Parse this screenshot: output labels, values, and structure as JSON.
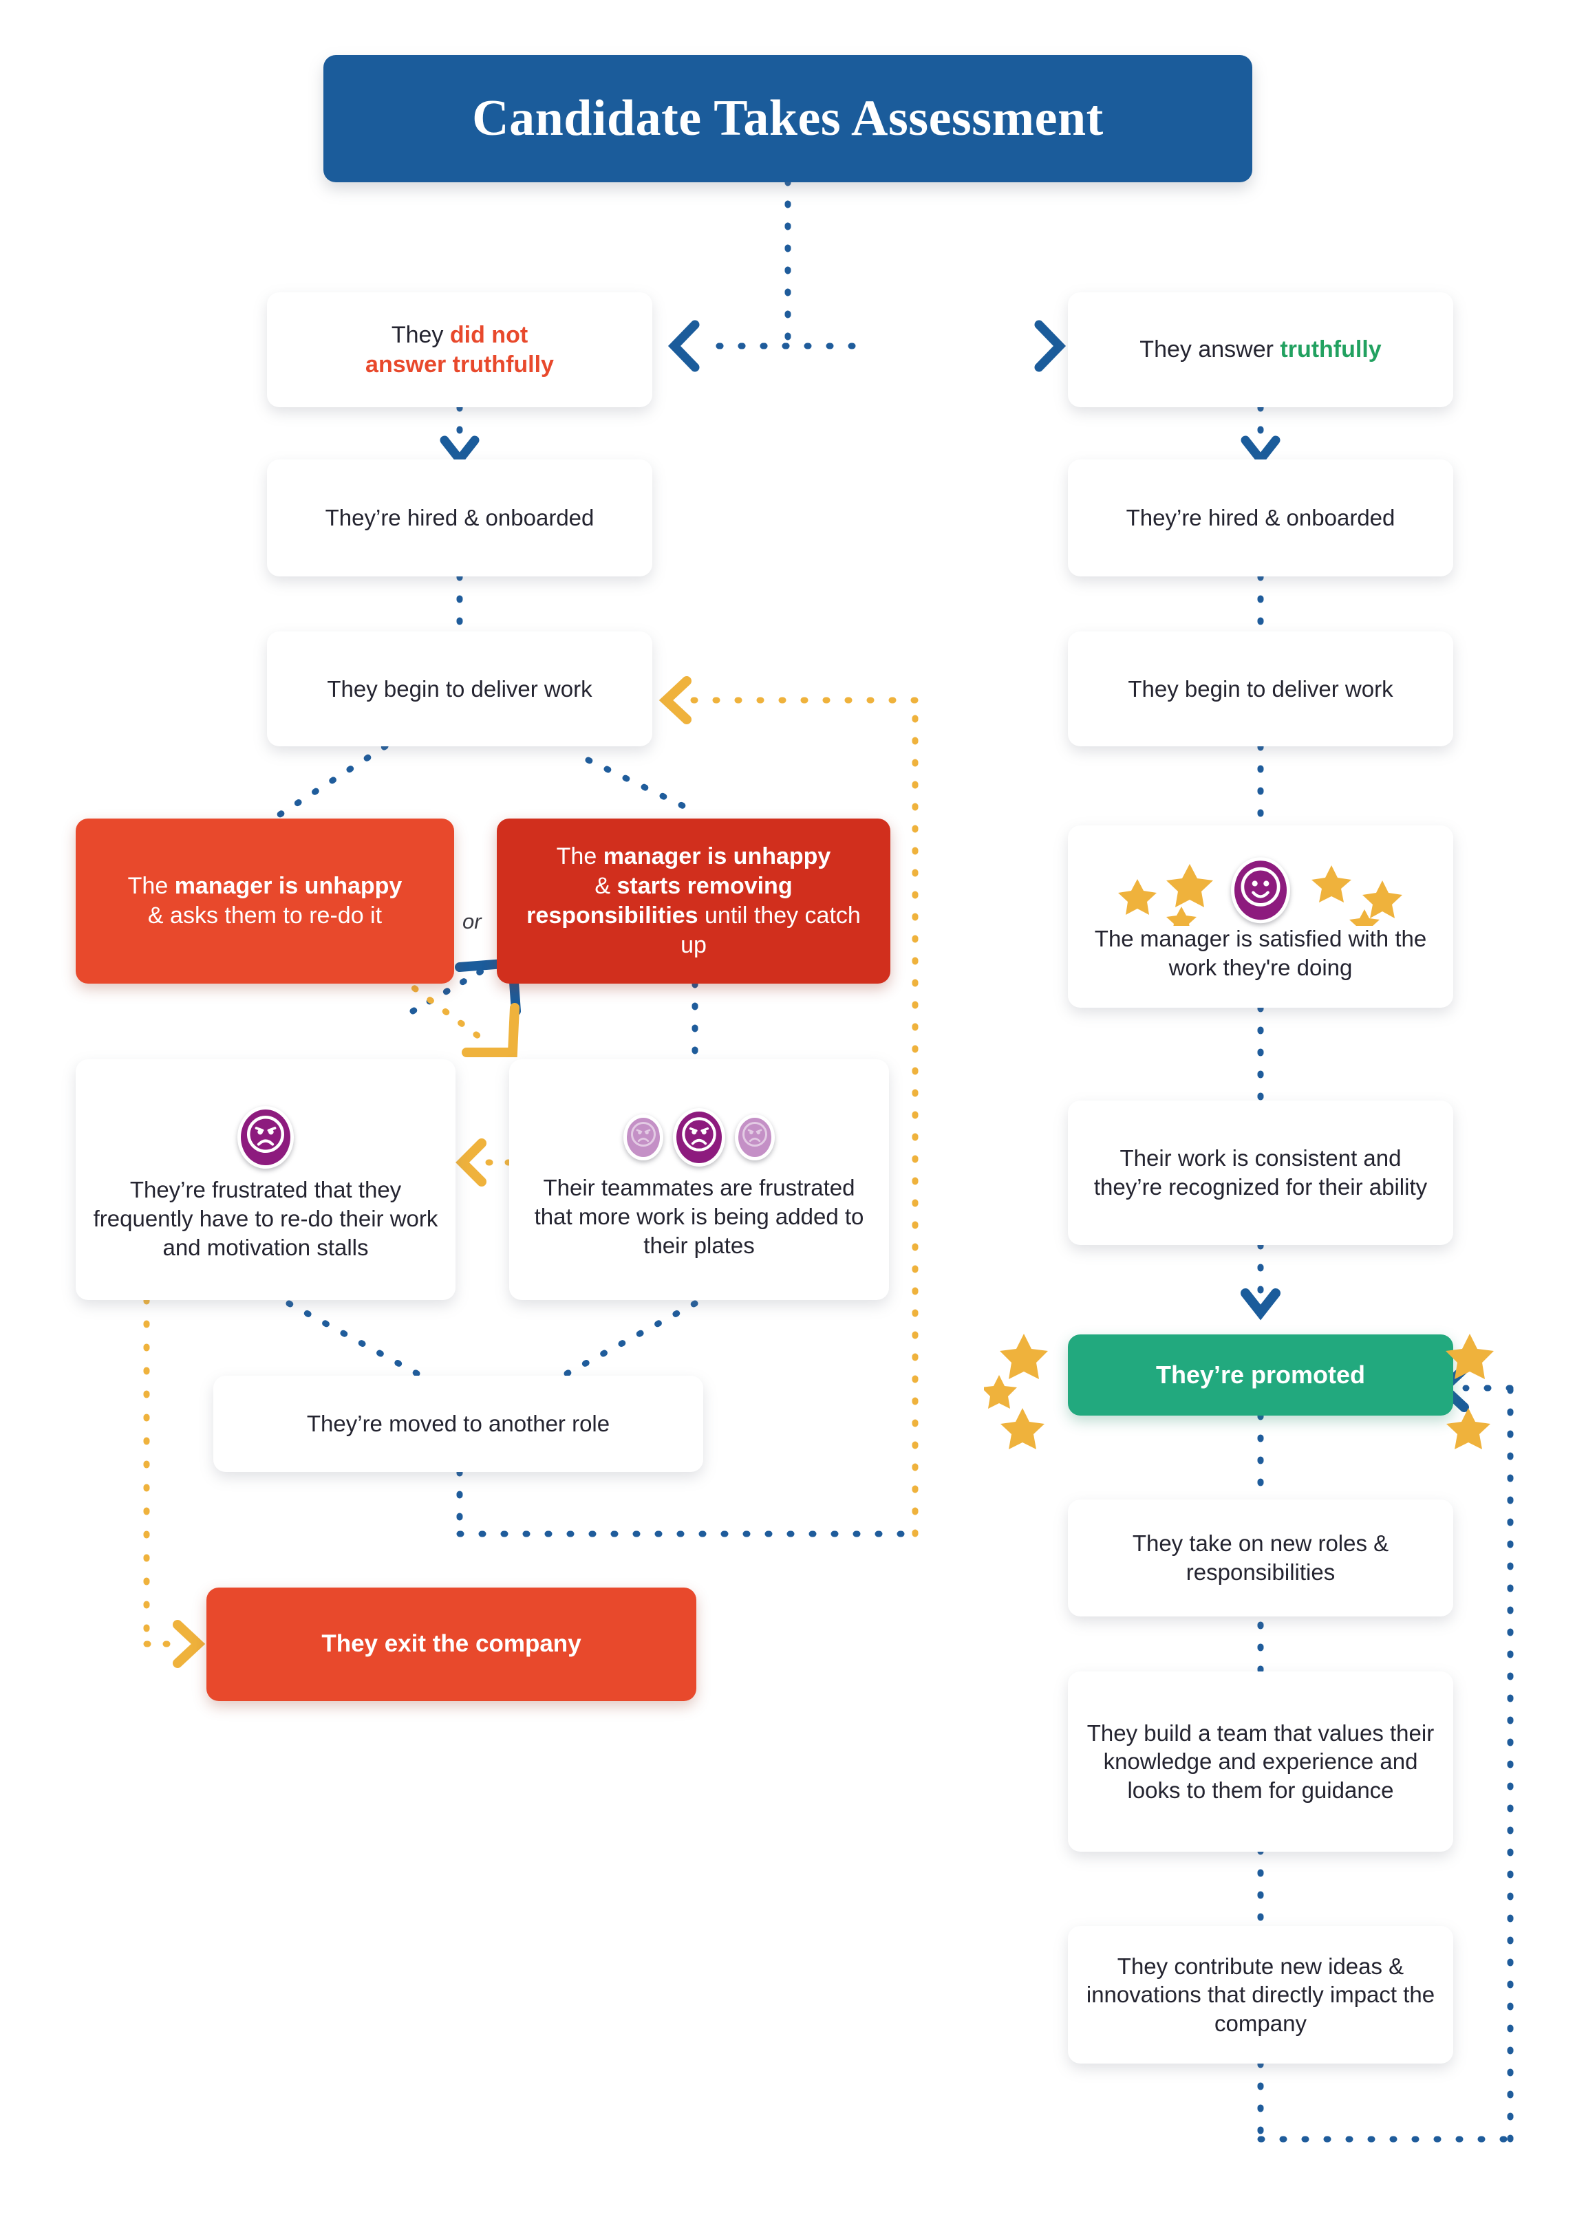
{
  "title": {
    "text": "Candidate Takes Assessment",
    "bg": "#1B5C9B"
  },
  "colors": {
    "blue": "#1B5C9B",
    "line_blue": "#1F5C9B",
    "amber": "#EFB23C",
    "red_light": "#E8492C",
    "red_dark": "#D12F1D",
    "green": "#22A97E",
    "purple": "#8D1B7E",
    "purple_pale": "#C490C6",
    "text": "#242430",
    "card": "#FFFFFF"
  },
  "branch_left": {
    "decision_prefix": "They ",
    "decision_emphasis": "did not",
    "decision_emphasis2": "answer truthfully",
    "steps": [
      {
        "id": "left-hired",
        "text": "They’re hired & onboarded"
      },
      {
        "id": "left-deliver",
        "text": "They begin to deliver work"
      }
    ],
    "manager_a": {
      "lead": "The ",
      "bold": "manager is unhappy",
      "tail": "& asks them to re-do it"
    },
    "or_label": "or",
    "manager_b": {
      "lead": "The ",
      "bold": "manager is unhappy",
      "mid": "& ",
      "bold2": "starts removing responsibilities",
      "tail": " until they catch up"
    },
    "frustrated_self": "They’re frustrated that they frequently have to re-do their work and motivation stalls",
    "frustrated_team": "Their teammates are frustrated that more work is being added to their plates",
    "moved_role": "They’re moved to another role",
    "exit": "They exit the company"
  },
  "branch_right": {
    "decision_prefix": "They answer ",
    "decision_emphasis": "truthfully",
    "steps": [
      {
        "id": "right-hired",
        "text": "They’re hired & onboarded"
      },
      {
        "id": "right-deliver",
        "text": "They begin to deliver work"
      }
    ],
    "satisfied": "The manager is satisfied with the work they're doing",
    "consistent": "Their work is consistent and they’re recognized for their ability",
    "promoted": "They’re promoted",
    "new_roles": "They take on new roles & responsibilities",
    "build_team": "They build a team that values their knowledge and experience and looks to them for guidance",
    "new_ideas": "They contribute new ideas & innovations that directly impact the company"
  },
  "icons": {
    "sad_face": "sad-face-icon",
    "happy_face": "happy-face-icon",
    "star": "star-icon",
    "chevron_down": "chevron-down-icon",
    "chevron_left": "chevron-left-icon",
    "chevron_right": "chevron-right-icon"
  }
}
